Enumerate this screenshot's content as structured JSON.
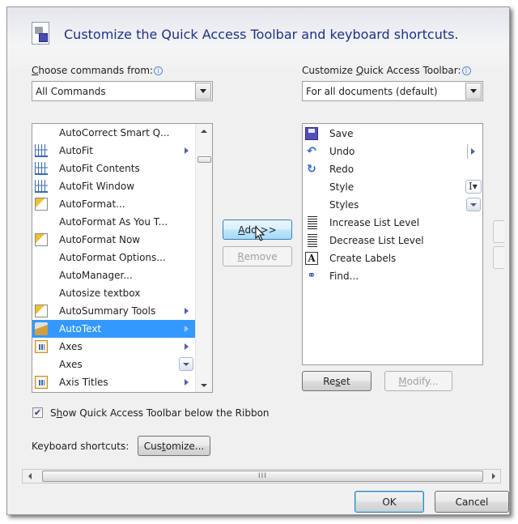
{
  "dialog": {
    "title": "Customize the Quick Access Toolbar and keyboard shortcuts."
  },
  "left": {
    "label_prefix": "",
    "label_access_key": "C",
    "label_rest": "hoose commands from:",
    "info_icon": "i",
    "combo_value": "All Commands",
    "items": [
      {
        "label": "AutoCorrect Smart Q...",
        "icon": "none",
        "submenu": false
      },
      {
        "label": "AutoFit",
        "icon": "table-autofit-icon",
        "submenu": true
      },
      {
        "label": "AutoFit Contents",
        "icon": "table-autofit-icon",
        "submenu": false
      },
      {
        "label": "AutoFit Window",
        "icon": "table-autofit-window-icon",
        "submenu": false
      },
      {
        "label": "AutoFormat...",
        "icon": "autoformat-icon",
        "submenu": false
      },
      {
        "label": "AutoFormat As You T...",
        "icon": "none",
        "submenu": false
      },
      {
        "label": "AutoFormat Now",
        "icon": "autoformat-icon",
        "submenu": false
      },
      {
        "label": "AutoFormat Options...",
        "icon": "none",
        "submenu": false
      },
      {
        "label": "AutoManager...",
        "icon": "none",
        "submenu": false
      },
      {
        "label": "Autosize textbox",
        "icon": "none",
        "submenu": false
      },
      {
        "label": "AutoSummary Tools",
        "icon": "autosummary-icon",
        "submenu": true
      },
      {
        "label": "AutoText",
        "icon": "autotext-icon",
        "submenu": true,
        "selected": true
      },
      {
        "label": "Axes",
        "icon": "chart-axes-icon",
        "submenu": true
      },
      {
        "label": "Axes",
        "icon": "none",
        "submenu": false,
        "dropdown": true
      },
      {
        "label": "Axis Titles",
        "icon": "chart-axis-titles-icon",
        "submenu": true
      }
    ]
  },
  "middle": {
    "add_access": "A",
    "add_rest": "dd >>",
    "remove_access": "R",
    "remove_rest": "emove"
  },
  "right": {
    "label_before": "Customize ",
    "label_access_key": "Q",
    "label_rest": "uick Access Toolbar:",
    "info_icon": "i",
    "combo_value": "For all documents (default)",
    "items": [
      {
        "label": "Save",
        "icon": "save-icon"
      },
      {
        "label": "Undo",
        "icon": "undo-icon",
        "submenu": true
      },
      {
        "label": "Redo",
        "icon": "redo-icon"
      },
      {
        "label": "Style",
        "icon": "none",
        "ibeam": true
      },
      {
        "label": "Styles",
        "icon": "none",
        "dropdown": true
      },
      {
        "label": "Increase List Level",
        "icon": "increase-list-level-icon"
      },
      {
        "label": "Decrease List Level",
        "icon": "decrease-list-level-icon"
      },
      {
        "label": "Create Labels",
        "icon": "create-labels-icon"
      },
      {
        "label": "Find...",
        "icon": "find-binoculars-icon"
      }
    ],
    "reset_before": "Re",
    "reset_access": "s",
    "reset_after": "et",
    "modify_access": "M",
    "modify_rest": "odify..."
  },
  "options": {
    "show_below_before": "S",
    "show_below_access": "h",
    "show_below_rest": "ow Quick Access Toolbar below the Ribbon",
    "show_below_checked": true,
    "keyboard_label": "Keyboard shortcuts:",
    "customize_before": "Cus",
    "customize_access": "t",
    "customize_rest": "omize..."
  },
  "hscroll_grip": "III",
  "footer": {
    "ok": "OK",
    "cancel": "Cancel"
  }
}
